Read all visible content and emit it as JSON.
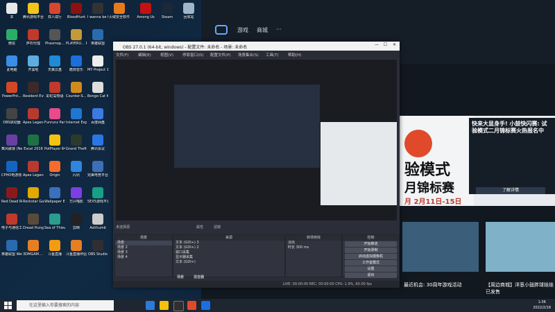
{
  "desktop_icons": [
    {
      "label": "本",
      "color": "#e8e8e8"
    },
    {
      "label": "腾讯游戏平台",
      "color": "#f0c419"
    },
    {
      "label": "双人成行",
      "color": "#d9462e"
    },
    {
      "label": "BloodHunt",
      "color": "#8a1212"
    },
    {
      "label": "I wanna be the Creator",
      "color": "#333"
    },
    {
      "label": "火绒安全软件",
      "color": "#e97a1a"
    },
    {
      "label": "Among Us",
      "color": "#c51111"
    },
    {
      "label": "Steam",
      "color": "#1b2838"
    },
    {
      "label": "回收站",
      "color": "#9fb6c8"
    },
    {
      "label": "微信",
      "color": "#2aae67"
    },
    {
      "label": "萨石代理",
      "color": "#c0392b"
    },
    {
      "label": "Phasmop...",
      "color": "#555"
    },
    {
      "label": "PLAYERU... BATTLEGR...",
      "color": "#c49a38"
    },
    {
      "label": "英雄联盟",
      "color": "#2a6bb0"
    },
    {
      "label": "此电脑",
      "color": "#3a8ee6"
    },
    {
      "label": "开黑啦",
      "color": "#5dade2"
    },
    {
      "label": "天翼云盘",
      "color": "#1f8ad6"
    },
    {
      "label": "酷狗音乐",
      "color": "#1a6fdc"
    },
    {
      "label": "MY Project 1.fxhumb",
      "color": "#eee"
    },
    {
      "label": "PowerPnt...",
      "color": "#d24726"
    },
    {
      "label": "Resident Evil 7 Bi...",
      "color": "#3a2a2a"
    },
    {
      "label": "彩虹岛物语",
      "color": "#c0392b"
    },
    {
      "label": "Counter-S... Global Off...",
      "color": "#d18b1c"
    },
    {
      "label": "Bongo Cat Mver - St...",
      "color": "#ddd"
    },
    {
      "label": "OBS启动器",
      "color": "#444"
    },
    {
      "label": "Apex Legends",
      "color": "#b83a2e"
    },
    {
      "label": "Funrunz Party",
      "color": "#e84a8a"
    },
    {
      "label": "Internet Explorer",
      "color": "#1f77d0"
    },
    {
      "label": "百度网盘",
      "color": "#3b7ae0"
    },
    {
      "label": "乘风破浪 (Nejiong...",
      "color": "#6b3fa0"
    },
    {
      "label": "Excel 2016",
      "color": "#1e7145"
    },
    {
      "label": "PotPlayer 64 bit",
      "color": "#f2c40f"
    },
    {
      "label": "Grand Theft Auto V",
      "color": "#2b3a2b"
    },
    {
      "label": "腾讯会议",
      "color": "#2a76e6"
    },
    {
      "label": "CPHO电游技术工具",
      "color": "#1565c0"
    },
    {
      "label": "Apex Legends",
      "color": "#b83a2e"
    },
    {
      "label": "Origin",
      "color": "#f56c2d"
    },
    {
      "label": "闪讯",
      "color": "#2e86de"
    },
    {
      "label": "完美电竞平台 2.0 港服版",
      "color": "#3c6fb6"
    },
    {
      "label": "Red Dead Redempti...",
      "color": "#8a1a1a"
    },
    {
      "label": "Rockstar Games...",
      "color": "#e0a800"
    },
    {
      "label": "Wallpaper Engine ...",
      "color": "#3a70c0"
    },
    {
      "label": "万兴喵影",
      "color": "#7b3fe4"
    },
    {
      "label": "5EX5游戏平台",
      "color": "#16a085"
    },
    {
      "label": "电子与通信工程学院综合...",
      "color": "#c0392b"
    },
    {
      "label": "Dread Hunger",
      "color": "#5a4a3a"
    },
    {
      "label": "Sea of Thieves",
      "color": "#2a9d8f"
    },
    {
      "label": "剪映",
      "color": "#222"
    },
    {
      "label": "Ashhumb",
      "color": "#ccc"
    },
    {
      "label": "英雄联盟 WeGame版",
      "color": "#2a6bb0"
    },
    {
      "label": "3DMGAM... 2.CHS.Patc...",
      "color": "#e67e22"
    },
    {
      "label": "斗鱼直播",
      "color": "#f39c12"
    },
    {
      "label": "斗鱼直播伴侣",
      "color": "#e67e22"
    },
    {
      "label": "OBS Studio",
      "color": "#302e31"
    }
  ],
  "web": {
    "nav_game": "游戏",
    "nav_mall": "商城",
    "nav_more": "···",
    "news_heading": "快来大显身手! 小鼓快闪赛: 试验模式二月锦标赛火热报名中",
    "banner_title": "验模式",
    "banner_sub": "月锦标赛",
    "banner_date": "月 2月11日-15日",
    "side_title": "快来大显身手! 小鼓快闪赛: 试验模式二月锦标赛火热报名中",
    "side_btn": "了解详情",
    "bottom_text1": "最近机会: 30周年游戏活动",
    "bottom_text2": "【周边商城】洋葱小鼓胖球娃娃已发售"
  },
  "obs": {
    "title": "OBS 27.0.1 (64-bit, windows) - 配置文件: 未命名 - 场景: 未命名",
    "menu": [
      "文件(F)",
      "编辑(E)",
      "视图(V)",
      "停靠窗口(D)",
      "配置文件(P)",
      "场景集合(S)",
      "工具(T)",
      "帮助(H)"
    ],
    "source_name": "未选择源",
    "props_label": "属性",
    "filters_label": "滤镜",
    "scenes_header": "场景",
    "scenes": [
      "场景",
      "场景 2",
      "场景 3",
      "场景 4"
    ],
    "sources_header": "来源",
    "sources": [
      "文本 (GDI+) 3",
      "文本 (GDI+) 2",
      "窗口采集",
      "显示器采集",
      "文本 (GDI+)"
    ],
    "transition_header": "转场特效",
    "transition": "淡出",
    "duration_label": "时长",
    "duration_value": "300 ms",
    "controls_header": "控制",
    "controls": [
      "开始推流",
      "开始录制",
      "启动虚拟摄像机",
      "工作室模式",
      "设置",
      "退出"
    ],
    "tab_scene": "场景",
    "tab_mixer": "混音器",
    "status": "LIVE: 00:00:00    REC: 00:00:00    CPU: 1.9%, 60.00 fps"
  },
  "taskbar": {
    "search_placeholder": "在这里输入你要搜索的内容",
    "time": "1:36",
    "date": "2022/2/18"
  }
}
